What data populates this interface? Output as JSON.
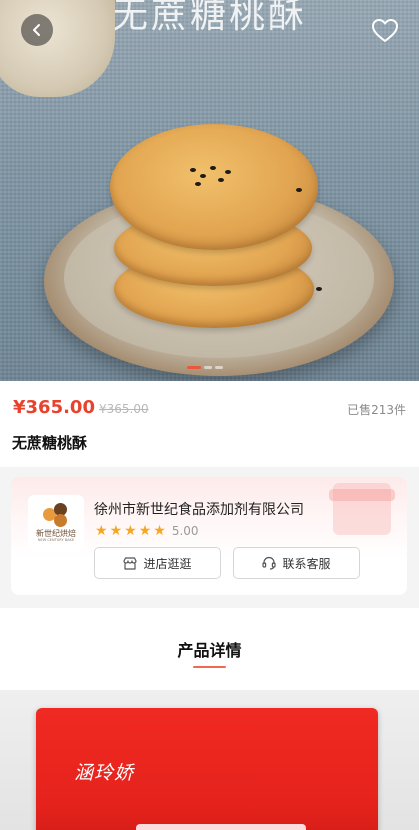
{
  "hero": {
    "watermark": "无蔗糖桃酥",
    "slides": 3,
    "active_slide": 1
  },
  "product": {
    "price": "¥365.00",
    "original_price": "¥365.00",
    "sold": "已售213件",
    "title": "无蔗糖桃酥"
  },
  "shop": {
    "logo_text": "新世纪烘焙",
    "logo_en": "NEW CENTURY BAKE",
    "name": "徐州市新世纪食品添加剂有限公司",
    "stars": 5,
    "rating": "5.00",
    "store_button": "进店逛逛",
    "service_button": "联系客服"
  },
  "detail": {
    "title": "产品详情",
    "package_brand": "涵玲娇"
  },
  "colors": {
    "price_red": "#e8412c",
    "accent": "#ef6b50",
    "star": "#f5a623"
  },
  "icons": {
    "back": "chevron-left-icon",
    "favorite": "heart-outline-icon",
    "store": "store-icon",
    "service": "headset-icon"
  }
}
